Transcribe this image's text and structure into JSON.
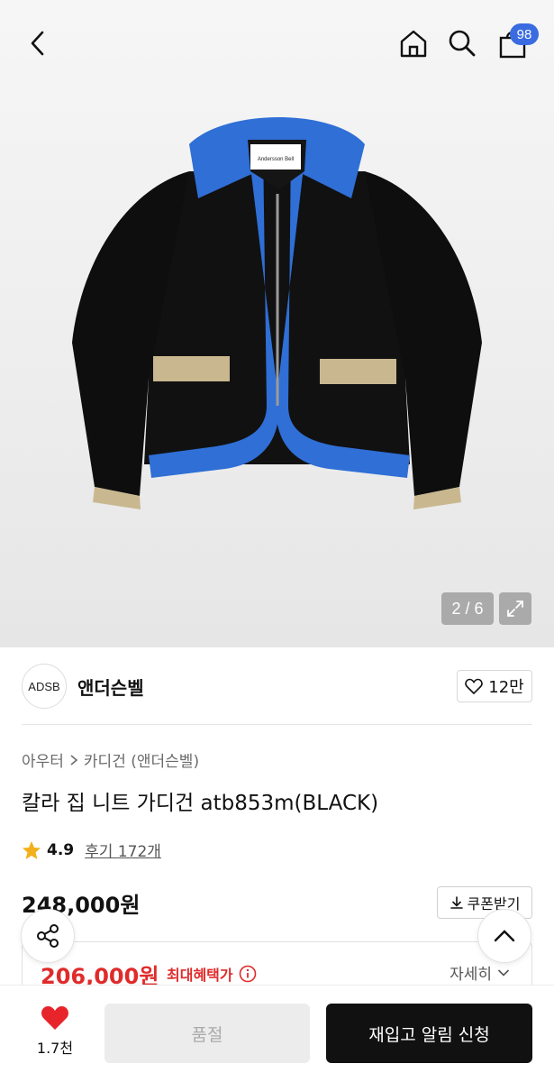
{
  "header": {
    "back_icon": "chevron-left-icon",
    "home_icon": "home-icon",
    "search_icon": "search-icon",
    "cart_icon": "shopping-bag-icon",
    "cart_count": "98"
  },
  "gallery": {
    "pager": "2 / 6",
    "expand_icon": "expand-icon",
    "tag_text": "Andersson Bell"
  },
  "brand": {
    "logo_text": "ADSB",
    "name": "앤더슨벨",
    "like_count": "12만"
  },
  "breadcrumb": {
    "level1": "아우터",
    "level2": "카디건 (앤더슨벨)"
  },
  "product": {
    "title": "칼라 집 니트 가디건 atb853m(BLACK)",
    "rating": "4.9",
    "reviews": "후기 172개",
    "price": "248,000원",
    "coupon_label": "쿠폰받기"
  },
  "benefit": {
    "sale_price": "206,000원",
    "max_label": "최대혜택가",
    "detail_label": "자세히"
  },
  "bottom": {
    "wish_count": "1.7천",
    "soldout_label": "품절",
    "restock_label": "재입고 알림 신청"
  },
  "colors": {
    "accent_red": "#e02b2b",
    "badge_blue": "#3a6be0",
    "cta_black": "#111111"
  }
}
